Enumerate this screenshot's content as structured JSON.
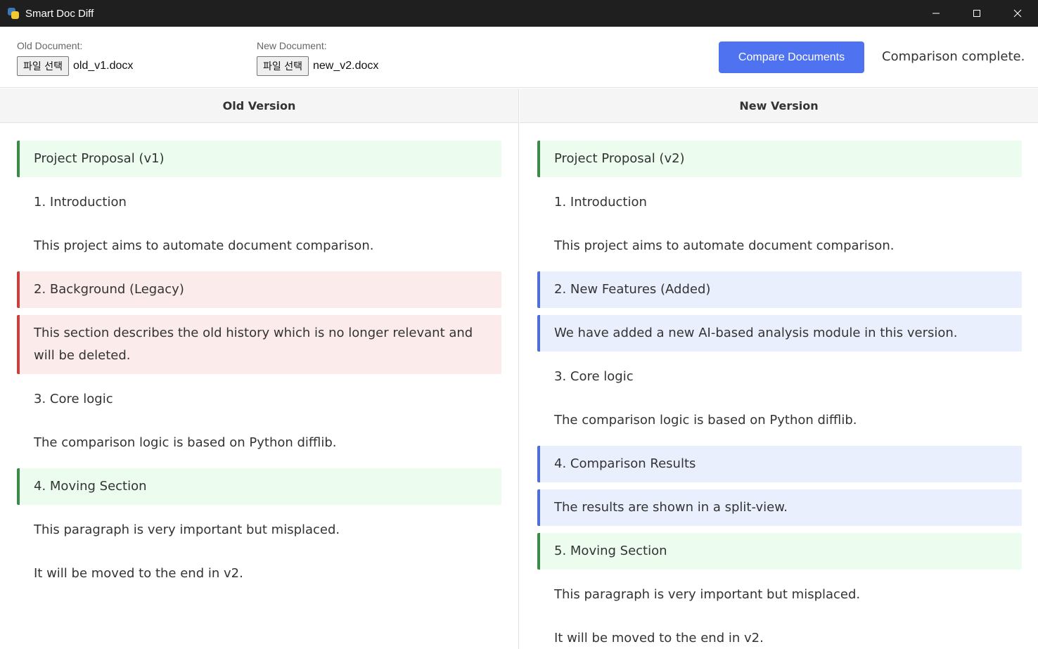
{
  "window": {
    "title": "Smart Doc Diff"
  },
  "toolbar": {
    "old_label": "Old Document:",
    "old_button": "파일 선택",
    "old_file": "old_v1.docx",
    "new_label": "New Document:",
    "new_button": "파일 선택",
    "new_file": "new_v2.docx",
    "compare_label": "Compare Documents",
    "status": "Comparison complete."
  },
  "old_pane": {
    "header": "Old Version",
    "blocks": [
      {
        "text": "Project Proposal (v1)",
        "kind": "moved"
      },
      {
        "text": "1. Introduction",
        "kind": "same"
      },
      {
        "text": "This project aims to automate document comparison.",
        "kind": "same"
      },
      {
        "text": "2. Background (Legacy)",
        "kind": "removed"
      },
      {
        "text": "This section describes the old history which is no longer relevant and will be deleted.",
        "kind": "removed"
      },
      {
        "text": "3. Core logic",
        "kind": "same"
      },
      {
        "text": "The comparison logic is based on Python difflib.",
        "kind": "same"
      },
      {
        "text": "4. Moving Section",
        "kind": "moved"
      },
      {
        "text": "This paragraph is very important but misplaced.",
        "kind": "same"
      },
      {
        "text": "It will be moved to the end in v2.",
        "kind": "same"
      }
    ]
  },
  "new_pane": {
    "header": "New Version",
    "blocks": [
      {
        "text": "Project Proposal (v2)",
        "kind": "moved"
      },
      {
        "text": "1. Introduction",
        "kind": "same"
      },
      {
        "text": "This project aims to automate document comparison.",
        "kind": "same"
      },
      {
        "text": "2. New Features (Added)",
        "kind": "added"
      },
      {
        "text": "We have added a new AI-based analysis module in this version.",
        "kind": "added"
      },
      {
        "text": "3. Core logic",
        "kind": "same"
      },
      {
        "text": "The comparison logic is based on Python difflib.",
        "kind": "same"
      },
      {
        "text": "4. Comparison Results",
        "kind": "added"
      },
      {
        "text": "The results are shown in a split-view.",
        "kind": "added"
      },
      {
        "text": "5. Moving Section",
        "kind": "moved"
      },
      {
        "text": "This paragraph is very important but misplaced.",
        "kind": "same"
      },
      {
        "text": "It will be moved to the end in v2.",
        "kind": "same"
      }
    ]
  },
  "colors": {
    "accent": "#4f73f0",
    "moved_bg": "#ecfdf0",
    "moved_border": "#3b8a4a",
    "removed_bg": "#fbeceb",
    "removed_border": "#c8413a",
    "added_bg": "#e9effd",
    "added_border": "#4f6ed6"
  },
  "icons": {
    "app": "python-icon",
    "minimize": "minimize-icon",
    "maximize": "maximize-icon",
    "close": "close-icon"
  }
}
